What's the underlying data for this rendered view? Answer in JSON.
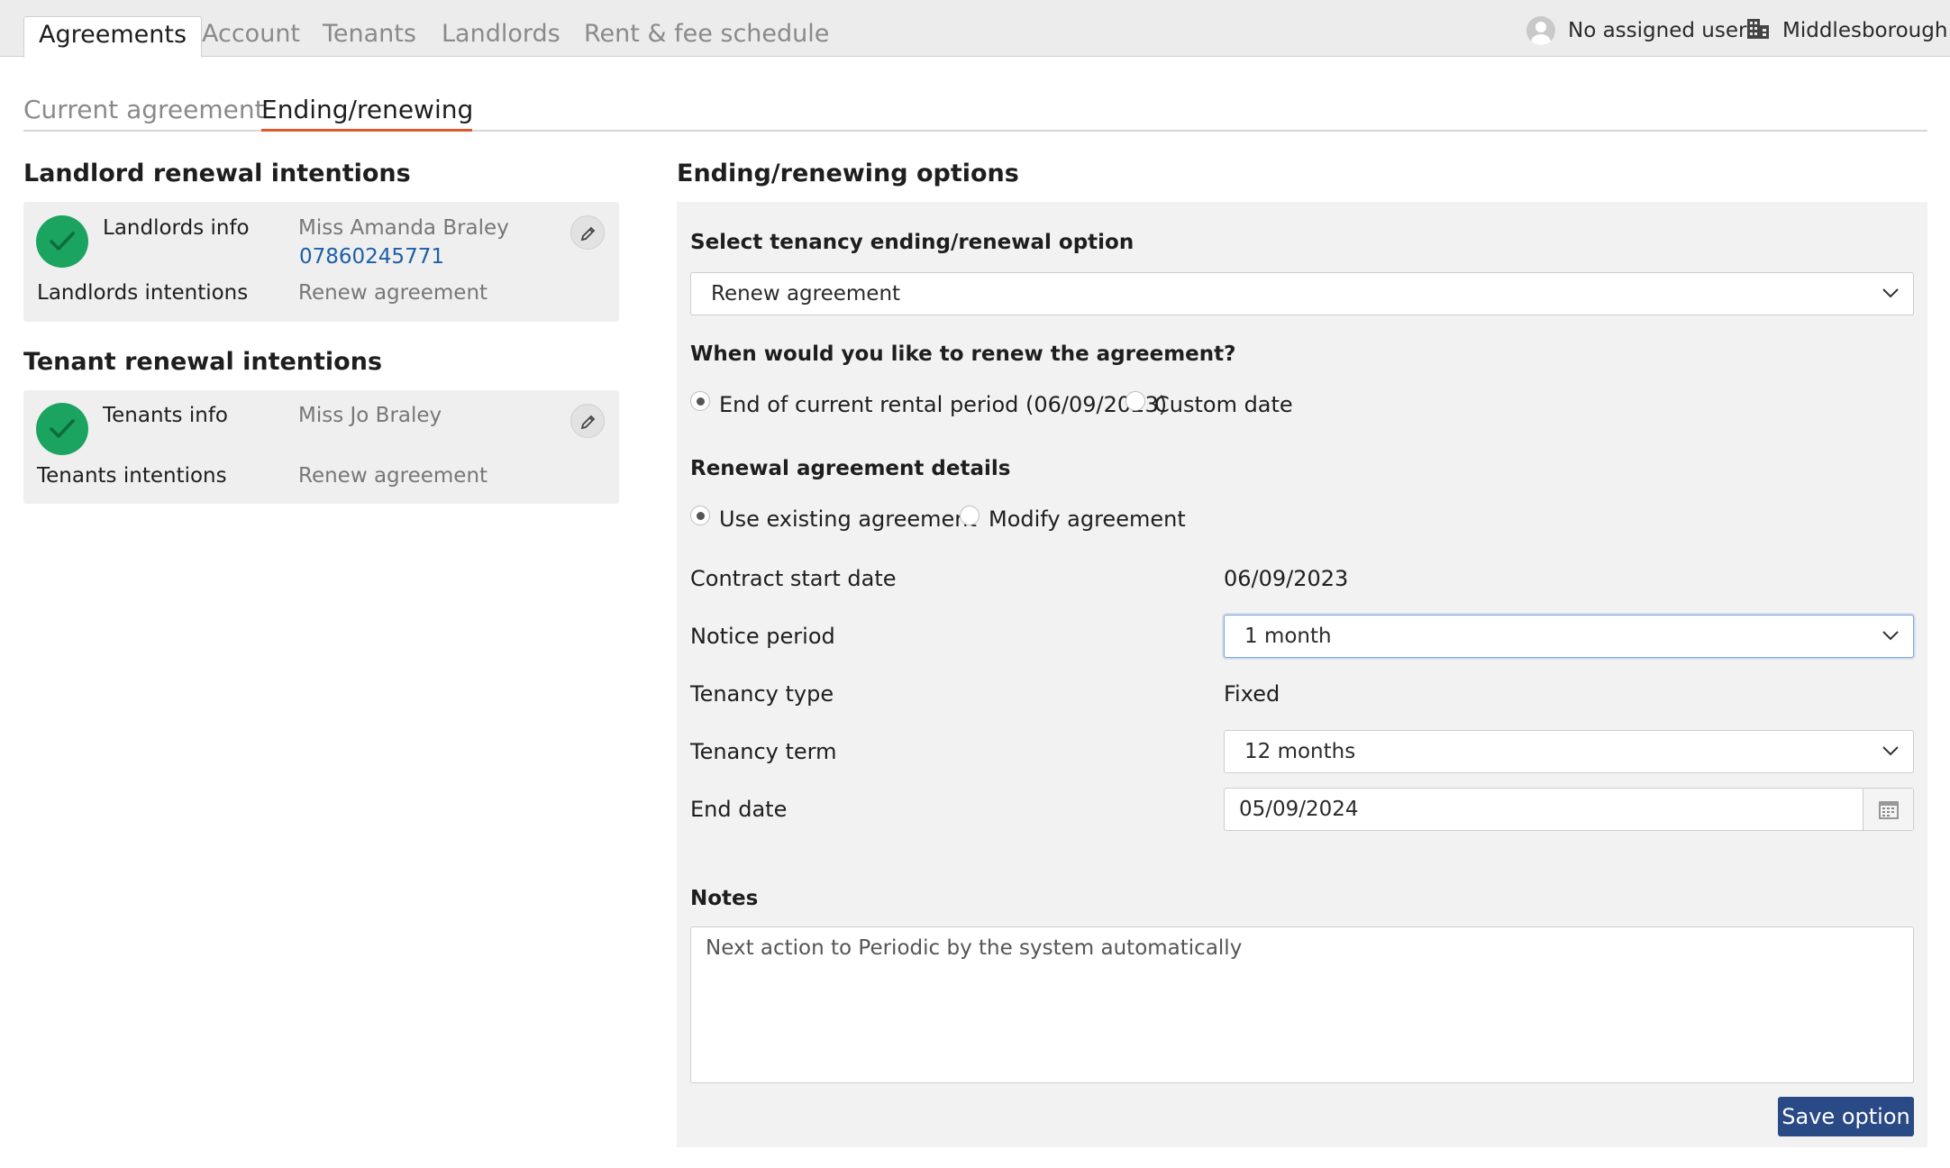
{
  "main_tabs": [
    {
      "label": "Agreements",
      "active": true
    },
    {
      "label": "Account"
    },
    {
      "label": "Tenants"
    },
    {
      "label": "Landlords"
    },
    {
      "label": "Rent & fee schedule"
    }
  ],
  "header": {
    "assigned_user": "No assigned user",
    "branch": "Middlesborough",
    "icons": {
      "user": "user-avatar-icon",
      "branch": "building-icon"
    }
  },
  "sub_tabs": [
    {
      "label": "Current agreement"
    },
    {
      "label": "Ending/renewing",
      "active": true
    }
  ],
  "landlord_section": {
    "title": "Landlord renewal intentions",
    "info_label": "Landlords info",
    "name": "Miss Amanda Braley",
    "phone": "07860245771",
    "intentions_label": "Landlords intentions",
    "intentions_value": "Renew agreement"
  },
  "tenant_section": {
    "title": "Tenant renewal intentions",
    "info_label": "Tenants info",
    "name": "Miss Jo Braley",
    "intentions_label": "Tenants intentions",
    "intentions_value": "Renew agreement"
  },
  "options": {
    "title": "Ending/renewing options",
    "select_label": "Select tenancy ending/renewal option",
    "select_value": "Renew agreement",
    "when_label": "When would you like to renew the agreement?",
    "when_options": [
      {
        "label": "End of current rental period (06/09/2023)",
        "checked": true
      },
      {
        "label": "Custom date",
        "checked": false
      }
    ],
    "details_label": "Renewal agreement details",
    "details_options": [
      {
        "label": "Use existing agreement",
        "checked": true
      },
      {
        "label": "Modify agreement",
        "checked": false
      }
    ],
    "contract_start_label": "Contract start date",
    "contract_start_value": "06/09/2023",
    "notice_label": "Notice period",
    "notice_value": "1 month",
    "tenancy_type_label": "Tenancy type",
    "tenancy_type_value": "Fixed",
    "tenancy_term_label": "Tenancy term",
    "tenancy_term_value": "12 months",
    "end_date_label": "End date",
    "end_date_value": "05/09/2024",
    "notes_label": "Notes",
    "notes_value": "Next action to Periodic by the system automatically",
    "save_label": "Save option"
  },
  "colors": {
    "accent": "#e0572b",
    "success": "#1aa460",
    "primary": "#2a4a86",
    "link": "#1d5fa8"
  }
}
